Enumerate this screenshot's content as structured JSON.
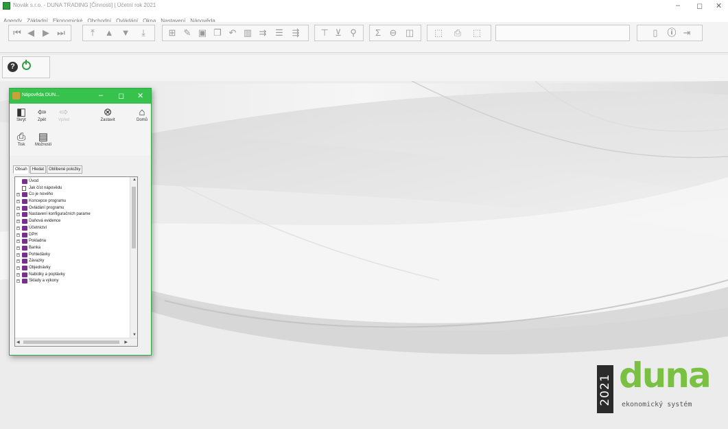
{
  "window": {
    "title": "Novák s.r.o. - DUNA TRADING [Činnosti] | Účetní rok 2021",
    "controls": {
      "minimize": "–",
      "maximize": "◻",
      "close": "✕"
    }
  },
  "menu": [
    "Agendy",
    "Základní",
    "Ekonomické",
    "Obchodní",
    "Ovládání",
    "Okna",
    "Nastavení",
    "Nápověda"
  ],
  "toolbar": {
    "nav": [
      "first-icon",
      "prev-icon",
      "next-icon",
      "last-icon"
    ],
    "sort": [
      "top-icon",
      "up-icon",
      "down-icon",
      "bottom-icon"
    ],
    "edit": [
      "new-icon",
      "edit-icon",
      "save-icon",
      "copy-icon",
      "undo-icon",
      "delete-icon",
      "insert-icon",
      "list-icon",
      "refresh-icon"
    ],
    "filter": [
      "filter-icon",
      "filter-clear-icon",
      "search-icon"
    ],
    "calc": [
      "sum-icon",
      "print-icon",
      "report-icon"
    ],
    "export": [
      "export-icon",
      "print2-icon",
      "import-icon"
    ],
    "right": [
      "doc-icon",
      "info-icon",
      "logout-icon"
    ]
  },
  "help_window": {
    "title": "Nápověda DUN...",
    "controls": {
      "minimize": "–",
      "maximize": "◻",
      "close": "✕"
    },
    "tools": [
      {
        "label": "Skrýt",
        "icon": "hide-icon",
        "glyph": "◧",
        "enabled": true
      },
      {
        "label": "Zpět",
        "icon": "back-icon",
        "glyph": "⇦",
        "enabled": true
      },
      {
        "label": "Vpřed",
        "icon": "forward-icon",
        "glyph": "⇨",
        "enabled": false
      },
      {
        "label": "Zastavit",
        "icon": "stop-icon",
        "glyph": "⊗",
        "enabled": true
      },
      {
        "label": "Domů",
        "icon": "home-icon",
        "glyph": "⌂",
        "enabled": true
      },
      {
        "label": "Tisk",
        "icon": "print-icon",
        "glyph": "⎙",
        "enabled": true
      },
      {
        "label": "Možnosti",
        "icon": "options-icon",
        "glyph": "▤",
        "enabled": true
      }
    ],
    "tabs": [
      {
        "label": "Obsah",
        "active": true
      },
      {
        "label": "Hledat",
        "active": false
      },
      {
        "label": "Oblíbené položky",
        "active": false
      }
    ],
    "tree": [
      {
        "label": "Úvod",
        "type": "book",
        "expandable": false
      },
      {
        "label": "Jak číst nápovědu",
        "type": "page",
        "expandable": false
      },
      {
        "label": "Co je nového",
        "type": "book",
        "expandable": true
      },
      {
        "label": "Koncepce programu",
        "type": "book",
        "expandable": true
      },
      {
        "label": "Ovládání programu",
        "type": "book",
        "expandable": true
      },
      {
        "label": "Nastavení konfiguračních parame",
        "type": "book",
        "expandable": true
      },
      {
        "label": "Daňová evidence",
        "type": "book",
        "expandable": true
      },
      {
        "label": "Účetnictví",
        "type": "book",
        "expandable": true
      },
      {
        "label": "DPH",
        "type": "book",
        "expandable": true
      },
      {
        "label": "Pokladna",
        "type": "book",
        "expandable": true
      },
      {
        "label": "Banka",
        "type": "book",
        "expandable": true
      },
      {
        "label": "Pohledávky",
        "type": "book",
        "expandable": true
      },
      {
        "label": "Závazky",
        "type": "book",
        "expandable": true
      },
      {
        "label": "Objednávky",
        "type": "book",
        "expandable": true
      },
      {
        "label": "Nabídky a poptávky",
        "type": "book",
        "expandable": true
      },
      {
        "label": "Sklady a výkony",
        "type": "book",
        "expandable": true
      }
    ]
  },
  "logo": {
    "year": "2021",
    "word": "duna",
    "tagline": "ekonomický systém",
    "accent": "#7ac143"
  }
}
